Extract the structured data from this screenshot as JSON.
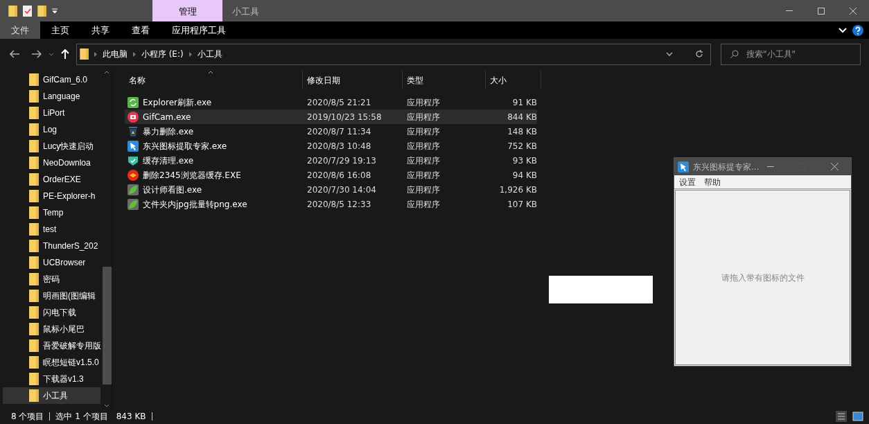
{
  "title_bar": {
    "context_tab": "管理",
    "title": "小工具"
  },
  "ribbon_tabs": [
    {
      "label": "文件",
      "selected": true
    },
    {
      "label": "主页",
      "selected": false
    },
    {
      "label": "共享",
      "selected": false
    },
    {
      "label": "查看",
      "selected": false
    },
    {
      "label": "应用程序工具",
      "selected": false
    }
  ],
  "address": {
    "breadcrumbs": [
      "此电脑",
      "小程序 (E:)",
      "小工具"
    ],
    "search_placeholder": "搜索\"小工具\""
  },
  "sidebar": {
    "items": [
      {
        "label": "GifCam_6.0",
        "selected": false
      },
      {
        "label": "Language",
        "selected": false
      },
      {
        "label": "LiPort",
        "selected": false
      },
      {
        "label": "Log",
        "selected": false
      },
      {
        "label": "Lucy快速启动",
        "selected": false
      },
      {
        "label": "NeoDownloa",
        "selected": false
      },
      {
        "label": "OrderEXE",
        "selected": false
      },
      {
        "label": "PE-Explorer-h",
        "selected": false
      },
      {
        "label": "Temp",
        "selected": false
      },
      {
        "label": "test",
        "selected": false
      },
      {
        "label": "ThunderS_202",
        "selected": false
      },
      {
        "label": "UCBrowser",
        "selected": false
      },
      {
        "label": "密码",
        "selected": false
      },
      {
        "label": "明画图(图编辑",
        "selected": false
      },
      {
        "label": "闪电下载",
        "selected": false
      },
      {
        "label": "鼠标小尾巴",
        "selected": false
      },
      {
        "label": "吾爱破解专用版",
        "selected": false
      },
      {
        "label": "瞑想短链v1.5.0",
        "selected": false
      },
      {
        "label": "下载器v1.3",
        "selected": false
      },
      {
        "label": "小工具",
        "selected": true
      }
    ]
  },
  "table": {
    "columns": [
      "名称",
      "修改日期",
      "类型",
      "大小"
    ],
    "rows": [
      {
        "kind": "refresh",
        "name": "Explorer刷新.exe",
        "date": "2020/8/5 21:21",
        "type": "应用程序",
        "size": "91 KB",
        "selected": false
      },
      {
        "kind": "camera",
        "name": "GifCam.exe",
        "date": "2019/10/23 15:58",
        "type": "应用程序",
        "size": "844 KB",
        "selected": true
      },
      {
        "kind": "bin",
        "name": "暴力删除.exe",
        "date": "2020/8/7 11:34",
        "type": "应用程序",
        "size": "148 KB",
        "selected": false
      },
      {
        "kind": "cursor",
        "name": "东兴图标提取专家.exe",
        "date": "2020/8/3 10:48",
        "type": "应用程序",
        "size": "752 KB",
        "selected": false
      },
      {
        "kind": "check",
        "name": "缓存清理.exe",
        "date": "2020/7/29 19:13",
        "type": "应用程序",
        "size": "93 KB",
        "selected": false
      },
      {
        "kind": "badge",
        "name": "删除2345浏览器缓存.EXE",
        "date": "2020/8/6 16:08",
        "type": "应用程序",
        "size": "94 KB",
        "selected": false
      },
      {
        "kind": "leaf",
        "name": "设计师看图.exe",
        "date": "2020/7/30 14:04",
        "type": "应用程序",
        "size": "1,926 KB",
        "selected": false
      },
      {
        "kind": "leaf",
        "name": "文件夹内jpg批量转png.exe",
        "date": "2020/8/5 12:33",
        "type": "应用程序",
        "size": "107 KB",
        "selected": false
      }
    ]
  },
  "status_bar": {
    "item_count": "8 个项目",
    "selection": "选中 1 个项目",
    "selection_size": "843 KB"
  },
  "tool_window": {
    "title": "东兴图标提专家...",
    "menu": [
      "设置",
      "帮助"
    ],
    "hint": "请拖入带有图标的文件"
  }
}
